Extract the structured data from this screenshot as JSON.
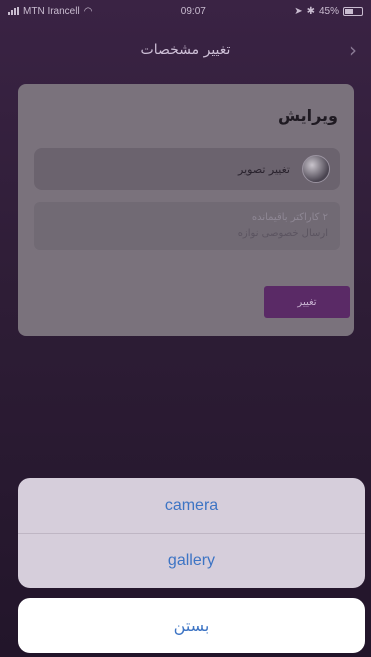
{
  "status_bar": {
    "carrier": "MTN Irancell",
    "time": "09:07",
    "battery": "45%"
  },
  "nav": {
    "title": "تغییر مشخصات",
    "back_icon": "chevron-right-icon"
  },
  "card": {
    "title": "ویرایش",
    "photo_label": "تغییر تصویر",
    "bio_lines": [
      "۲ کاراکتر باقیمانده",
      "ارسال خصوصی نوازه"
    ],
    "submit_label": "تغییر"
  },
  "action_sheet": {
    "options": [
      "camera",
      "gallery"
    ],
    "cancel_label": "بستن"
  },
  "colors": {
    "background": "#2e1d36",
    "accent": "#5a2a66",
    "action_text": "#3d74c4"
  }
}
